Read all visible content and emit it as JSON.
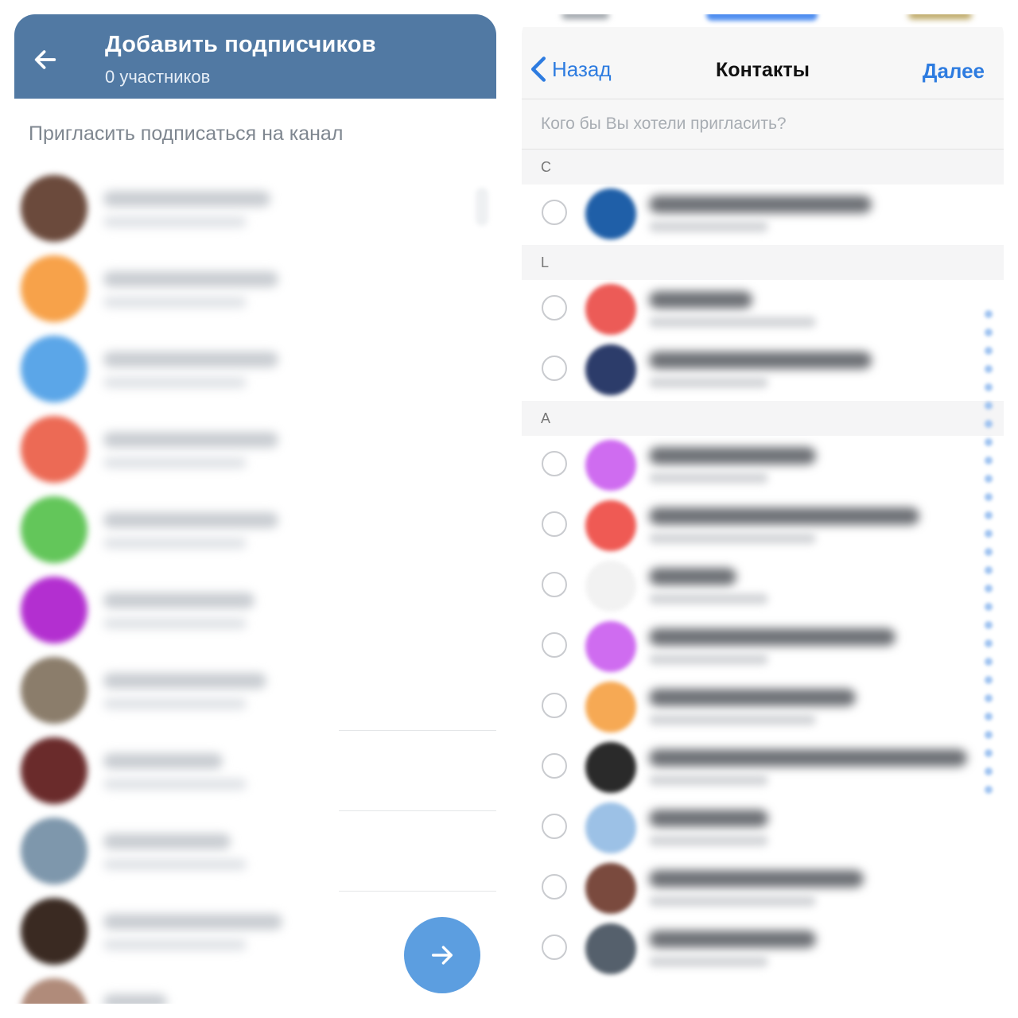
{
  "left_screen": {
    "header": {
      "title": "Добавить подписчиков",
      "subtitle": "0 участников",
      "back_icon": "arrow-left-icon",
      "background": "#5179a3"
    },
    "invite_link_label": "Пригласить подписаться на канал",
    "contacts": [
      {
        "avatar_color": "#6b4a3c"
      },
      {
        "avatar_color": "#f7a24a"
      },
      {
        "avatar_color": "#5ba6e8"
      },
      {
        "avatar_color": "#ec6a55"
      },
      {
        "avatar_color": "#63c65a"
      },
      {
        "avatar_color": "#b32fd0"
      },
      {
        "avatar_color": "#8b7d6b"
      },
      {
        "avatar_color": "#6a2b2b"
      },
      {
        "avatar_color": "#7e97ac"
      },
      {
        "avatar_color": "#3a2a22"
      },
      {
        "avatar_color": "#b08b7a"
      }
    ],
    "fab_icon": "arrow-right-icon",
    "fab_color": "#5c9ee0"
  },
  "right_screen": {
    "nav": {
      "back_label": "Назад",
      "back_icon": "chevron-left-icon",
      "title": "Контакты",
      "next_label": "Далее",
      "accent": "#2e7ce0"
    },
    "search": {
      "placeholder": "Кого бы Вы хотели пригласить?"
    },
    "sections": [
      {
        "letter": "C",
        "contacts": [
          {
            "avatar_color": "#1f5fa8"
          }
        ]
      },
      {
        "letter": "L",
        "contacts": [
          {
            "avatar_color": "#ec5b57"
          },
          {
            "avatar_color": "#2c3c6a"
          }
        ]
      },
      {
        "letter": "А",
        "contacts": [
          {
            "avatar_color": "#cf6cf0"
          },
          {
            "avatar_color": "#ef5a54"
          },
          {
            "avatar_color": "#f2f2f2"
          },
          {
            "avatar_color": "#cf6cf0"
          },
          {
            "avatar_color": "#f6a954"
          },
          {
            "avatar_color": "#2a2a2a"
          },
          {
            "avatar_color": "#9cc1e6"
          },
          {
            "avatar_color": "#7a4a3e"
          },
          {
            "avatar_color": "#55606c"
          }
        ]
      }
    ]
  }
}
